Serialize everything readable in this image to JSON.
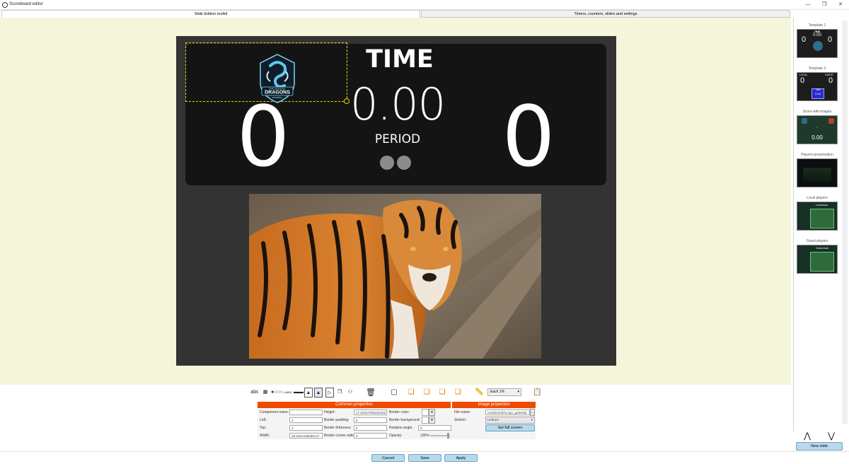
{
  "window": {
    "title": "Scoreboard editor",
    "minimize": "—",
    "maximize": "❐",
    "close": "✕"
  },
  "tabs": [
    {
      "label": "Slide Edition toolkit",
      "active": true
    },
    {
      "label": "Timers, counters, slides and settings",
      "active": false
    }
  ],
  "colors": {
    "canvas_bg": "#f5f5dc",
    "slide_bg": "#333333",
    "board_bg": "#141414",
    "accent": "#f04a00",
    "button": "#b9d9ea",
    "selection": "#e6d900"
  },
  "scoreboard": {
    "time_label": "TIME",
    "time_value": "0.00",
    "local_score": "0",
    "guest_score": "0",
    "period_label": "PERIOD",
    "period_dots": 2,
    "logo": {
      "line1": "THE CELESTIAL",
      "line2": "DRAGONS",
      "line3": "FOOTBALL"
    }
  },
  "templates": [
    {
      "label": "Template 1",
      "time": "TIME",
      "value": "0.00",
      "left": "0",
      "right": "0"
    },
    {
      "label": "Template 2",
      "local": "LOCAL",
      "guest": "GUEST",
      "left": "0",
      "right": "0",
      "time": "TIME",
      "value": "0.00"
    },
    {
      "label": "Score with images",
      "value": "0.00",
      "sep": "-"
    },
    {
      "label": "Players presentation"
    },
    {
      "label": "Local players",
      "team": "Local team"
    },
    {
      "label": "Guest players",
      "team": "Guest team"
    }
  ],
  "sidebar": {
    "up": "⋀",
    "down": "⋁",
    "new_slide": "New slide"
  },
  "toolbar": {
    "text_tool": "abc",
    "step_select": "Each 1%",
    "icons": [
      "text-icon",
      "qr-icon",
      "dots-icon",
      "label-icon",
      "counter-icon",
      "image-icon",
      "image-selected-icon",
      "video-icon",
      "gallery-icon",
      "players-icon",
      "trash-icon",
      "frame-icon",
      "bring-front-icon",
      "send-forward-icon",
      "send-backward-icon",
      "send-back-icon",
      "ruler-icon",
      "paste-icon"
    ]
  },
  "common_properties": {
    "title": "Common properties",
    "component_name_label": "Component name:",
    "component_name": "",
    "left_label": "Left:",
    "left": "2",
    "top_label": "Top:",
    "top": "2",
    "width_label": "Width:",
    "width": "28.6404165055147",
    "height_label": "Height:",
    "height": "17.82157006232262",
    "border_padding_label": "Border padding:",
    "border_padding": "0",
    "border_thickness_label": "Border thickness:",
    "border_thickness": "0",
    "border_corner_label": "Border corner radiu:",
    "border_corner": "0",
    "border_color_label": "Border color:",
    "border_background_label": "Border background:",
    "rotation_label": "Rotation angle:",
    "rotation": "0",
    "opacity_label": "Opacity:",
    "opacity": "100%"
  },
  "image_properties": {
    "title": "Image properties",
    "file_name_label": "File name:",
    "file_name": "media\\clubs\\Logo_galestial",
    "stretch_label": "Stretch:",
    "stretch": "Uniform",
    "full_screen": "Set full screen"
  },
  "bottom": {
    "cancel": "Cancel",
    "save": "Save",
    "apply": "Apply"
  }
}
